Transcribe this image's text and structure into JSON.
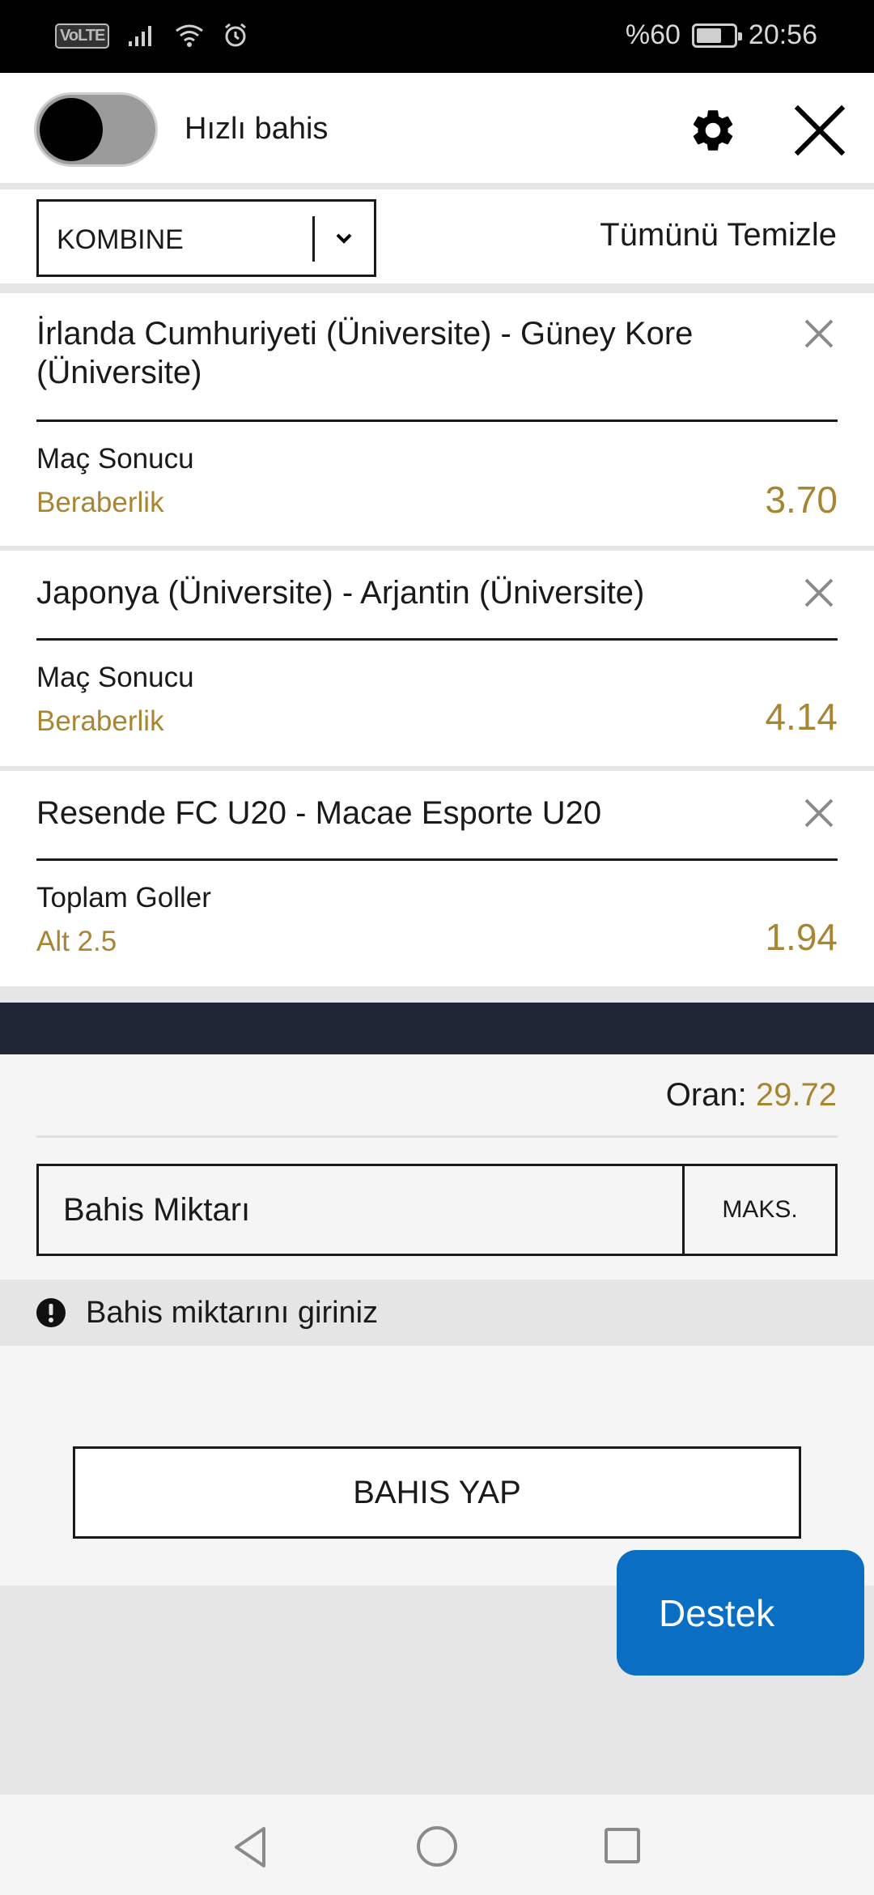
{
  "status_bar": {
    "volte": "VoLTE",
    "battery_text": "%60",
    "battery_level": 0.6,
    "time": "20:56"
  },
  "header": {
    "quick_bet_label": "Hızlı bahis",
    "quick_bet_enabled": false
  },
  "toolbar": {
    "bet_type": "KOMBINE",
    "clear_all": "Tümünü Temizle"
  },
  "bets": [
    {
      "match": "İrlanda Cumhuriyeti (Üniversite) - Güney Kore (Üniversite)",
      "market": "Maç Sonucu",
      "pick": "Beraberlik",
      "odd": "3.70"
    },
    {
      "match": "Japonya (Üniversite) - Arjantin (Üniversite)",
      "market": "Maç Sonucu",
      "pick": "Beraberlik",
      "odd": "4.14"
    },
    {
      "match": "Resende FC U20 - Macae Esporte U20",
      "market": "Toplam Goller",
      "pick": "Alt 2.5",
      "odd": "1.94"
    }
  ],
  "summary": {
    "odds_label": "Oran:",
    "odds_value": "29.72",
    "stake_placeholder": "Bahis Miktarı",
    "max_button": "MAKS.",
    "warning": "Bahis miktarını giriniz",
    "submit_button": "BAHIS YAP"
  },
  "support_button": "Destek",
  "colors": {
    "accent_gold": "#a88532",
    "dark_band": "#212636",
    "support_blue": "#0a6fc2"
  },
  "icons": [
    "signal-icon",
    "wifi-icon",
    "alarm-icon",
    "battery-icon",
    "gear-icon",
    "close-icon",
    "chevron-down-icon",
    "remove-icon",
    "warning-icon",
    "back-icon",
    "home-icon",
    "recent-apps-icon"
  ]
}
